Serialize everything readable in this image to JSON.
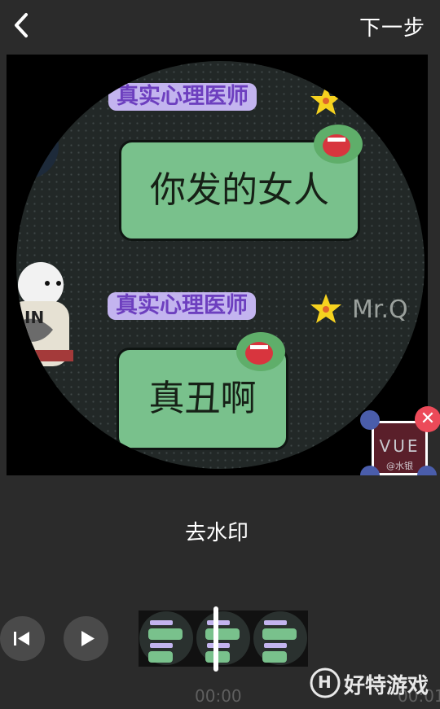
{
  "header": {
    "next_label": "下一步"
  },
  "preview": {
    "tag_top": "真实心理医师",
    "bubble_top": "你发的女人",
    "tag_bottom": "真实心理医师",
    "bubble_bottom": "真丑啊",
    "credit": "Mr.Q",
    "bear_text": "IN"
  },
  "watermark": {
    "text": "VUE",
    "sub": "@水银"
  },
  "actions": {
    "remove_watermark": "去水印"
  },
  "timeline": {
    "current_time": "00:00",
    "end_time": "00:01"
  },
  "branding": {
    "site_name": "好特游戏",
    "logo_letter": "H"
  },
  "colors": {
    "accent_handle": "#4a5dab",
    "close": "#ec4a59",
    "bubble_green": "#79c18c",
    "tag_purple": "#c3b4ef"
  }
}
